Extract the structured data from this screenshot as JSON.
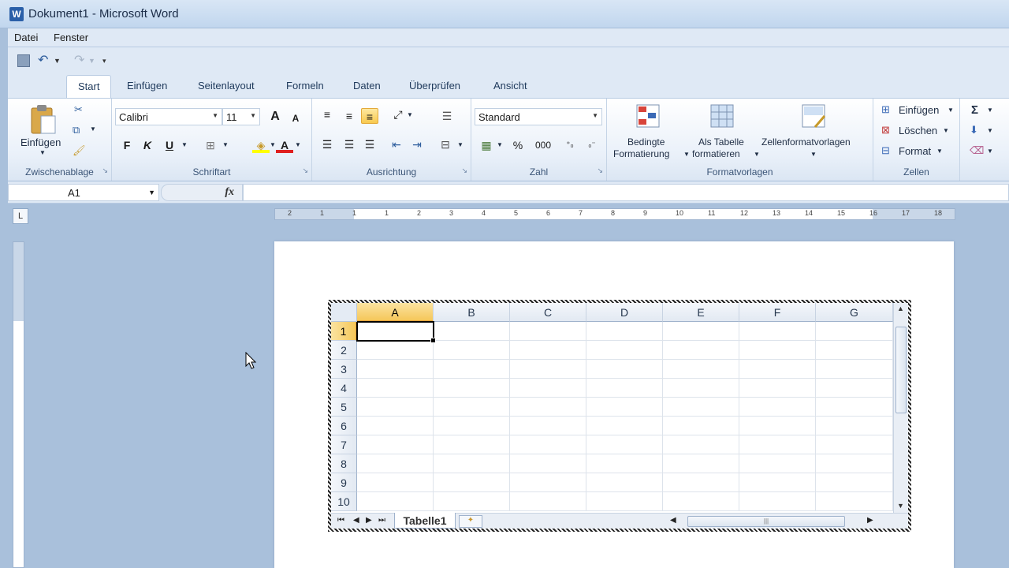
{
  "window": {
    "app_icon": "W",
    "title": "Dokument1 - Microsoft Word"
  },
  "menu": [
    "Datei",
    "Fenster"
  ],
  "tabs": [
    "Start",
    "Einfügen",
    "Seitenlayout",
    "Formeln",
    "Daten",
    "Überprüfen",
    "Ansicht"
  ],
  "ribbon": {
    "clipboard": {
      "label": "Zwischenablage",
      "paste": "Einfügen"
    },
    "font": {
      "label": "Schriftart",
      "font_name": "Calibri",
      "font_size": "11",
      "bold": "F",
      "italic": "K",
      "underline": "U",
      "grow": "A",
      "shrink": "A",
      "color_a": "A"
    },
    "alignment": {
      "label": "Ausrichtung"
    },
    "number": {
      "label": "Zahl",
      "format": "Standard",
      "percent": "%",
      "thousands": "000"
    },
    "styles": {
      "label": "Formatvorlagen",
      "conditional_1": "Bedingte",
      "conditional_2": "Formatierung",
      "as_table_1": "Als Tabelle",
      "as_table_2": "formatieren",
      "cell_styles": "Zellenformatvorlagen"
    },
    "cells": {
      "label": "Zellen",
      "insert": "Einfügen",
      "delete": "Löschen",
      "format": "Format"
    },
    "editing": {
      "sigma": "Σ"
    }
  },
  "formula_bar": {
    "name_box": "A1",
    "fx": "fx",
    "value": ""
  },
  "ruler": {
    "numbers": [
      "2",
      "1",
      "1",
      "1",
      "2",
      "3",
      "4",
      "5",
      "6",
      "7",
      "8",
      "9",
      "10",
      "11",
      "12",
      "13",
      "14",
      "15",
      "16",
      "17",
      "18"
    ]
  },
  "sheet": {
    "columns": [
      "A",
      "B",
      "C",
      "D",
      "E",
      "F",
      "G"
    ],
    "rows": [
      "1",
      "2",
      "3",
      "4",
      "5",
      "6",
      "7",
      "8",
      "9",
      "10"
    ],
    "active_cell": "A1",
    "sheet_tab": "Tabelle1"
  }
}
